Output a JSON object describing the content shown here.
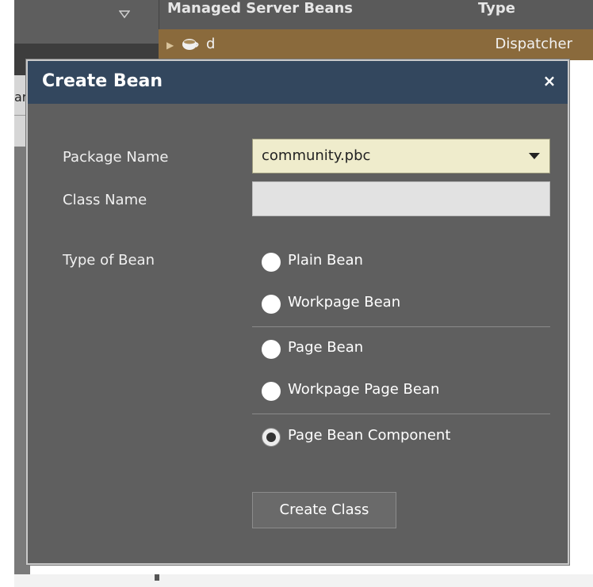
{
  "background": {
    "left_label_fragment": "ar",
    "table": {
      "col_name_header": "Managed Server Beans",
      "col_type_header": "Type",
      "row_name": "d",
      "row_type": "Dispatcher"
    }
  },
  "dialog": {
    "title": "Create Bean",
    "close_label": "×",
    "fields": {
      "package_label": "Package Name",
      "package_value": "community.pbc",
      "class_label": "Class Name",
      "class_value": "",
      "type_label": "Type of Bean"
    },
    "bean_types": [
      {
        "label": "Plain Bean",
        "checked": false
      },
      {
        "label": "Workpage Bean",
        "checked": false
      },
      {
        "label": "Page Bean",
        "checked": false
      },
      {
        "label": "Workpage Page Bean",
        "checked": false
      },
      {
        "label": "Page Bean Component",
        "checked": true
      }
    ],
    "submit_label": "Create Class"
  },
  "colors": {
    "dialog_header": "#33475e",
    "dialog_body": "#5f5f5f",
    "selected_row": "#8a6a3c",
    "select_bg": "#efeccc"
  },
  "icons": [
    "chevron-down-icon",
    "expand-arrow-icon",
    "bean-cup-icon",
    "close-icon",
    "dropdown-arrow-icon"
  ]
}
